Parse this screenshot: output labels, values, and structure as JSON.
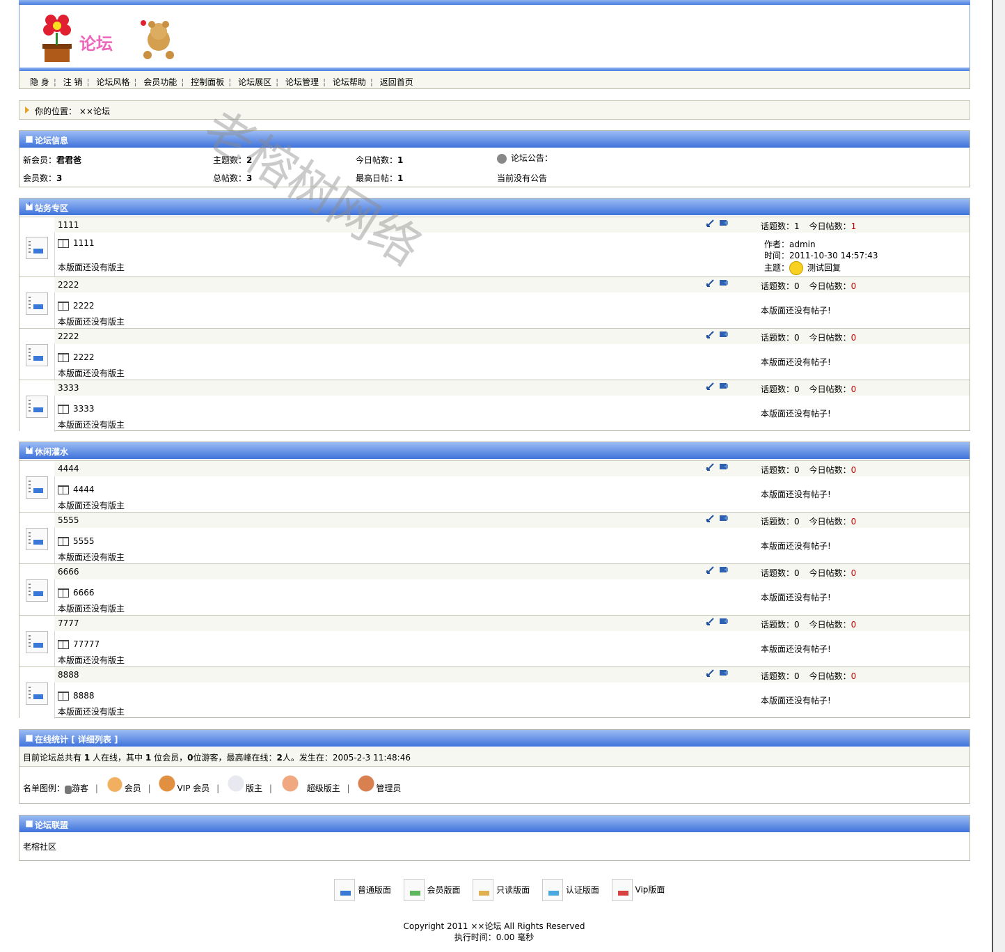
{
  "logo": {
    "text": "论坛"
  },
  "nav": [
    {
      "label": "隐 身"
    },
    {
      "label": "注 销"
    },
    {
      "label": "论坛风格"
    },
    {
      "label": "会员功能"
    },
    {
      "label": "控制面板"
    },
    {
      "label": "论坛展区"
    },
    {
      "label": "论坛管理"
    },
    {
      "label": "论坛帮助"
    },
    {
      "label": "返回首页"
    }
  ],
  "breadcrumb": {
    "prefix": "你的位置：",
    "location": "××论坛"
  },
  "info": {
    "title": "论坛信息",
    "new_member_label": "新会员：",
    "new_member": "君君爸",
    "topics_label": "主题数：",
    "topics": "2",
    "today_label": "今日帖数：",
    "today": "1",
    "announce_label": "论坛公告：",
    "members_label": "会员数：",
    "members": "3",
    "posts_label": "总帖数：",
    "posts": "3",
    "maxday_label": "最高日帖：",
    "maxday": "1",
    "announce_text": "当前没有公告"
  },
  "labels": {
    "topics": "话题数：",
    "today": "今日帖数：",
    "no_moderator": "本版面还没有版主",
    "no_posts": "本版面还没有帖子!",
    "author": "作者：",
    "time": "时间：",
    "subject": "主题："
  },
  "section1": {
    "title": "站务专区",
    "boards": [
      {
        "name": "1111",
        "desc": "1111",
        "topics": "1",
        "today": "1",
        "last": {
          "author": "admin",
          "time": "2011-10-30 14:57:43",
          "subject": "测试回复"
        }
      },
      {
        "name": "2222",
        "desc": "2222",
        "topics": "0",
        "today": "0"
      },
      {
        "name": "2222",
        "desc": "2222",
        "topics": "0",
        "today": "0"
      },
      {
        "name": "3333",
        "desc": "3333",
        "topics": "0",
        "today": "0"
      }
    ]
  },
  "section2": {
    "title": "休闲灌水",
    "boards": [
      {
        "name": "4444",
        "desc": "4444",
        "topics": "0",
        "today": "0"
      },
      {
        "name": "5555",
        "desc": "5555",
        "topics": "0",
        "today": "0"
      },
      {
        "name": "6666",
        "desc": "6666",
        "topics": "0",
        "today": "0"
      },
      {
        "name": "7777",
        "desc": "77777",
        "topics": "0",
        "today": "0"
      },
      {
        "name": "8888",
        "desc": "8888",
        "topics": "0",
        "today": "0"
      }
    ]
  },
  "online": {
    "title": "在线统计",
    "detail_link": "[ 详细列表 ]",
    "p1": "目前论坛总共有",
    "total": "1",
    "p2": "人在线，其中",
    "members": "1",
    "p3": "位会员，",
    "guests": "0",
    "p4": "位游客，最高峰在线：",
    "peak": "2",
    "p5": "人。发生在：2005-2-3 11:48:46",
    "legend_label": "名单图例：",
    "legend": [
      "游客",
      "会员",
      "VIP 会员",
      "版主",
      "超级版主",
      "管理员"
    ]
  },
  "union": {
    "title": "论坛联盟",
    "item": "老榕社区"
  },
  "footer_types": [
    {
      "label": "普通版面",
      "color": "#3a78d8"
    },
    {
      "label": "会员版面",
      "color": "#5cb85c"
    },
    {
      "label": "只读版面",
      "color": "#e0b050"
    },
    {
      "label": "认证版面",
      "color": "#4aa8e0"
    },
    {
      "label": "Vip版面",
      "color": "#d84040"
    }
  ],
  "footer": {
    "copyright": "Copyright 2011 ××论坛 All Rights Reserved",
    "exec": "执行时间：0.00 毫秒"
  },
  "watermark": "老榕树网络"
}
